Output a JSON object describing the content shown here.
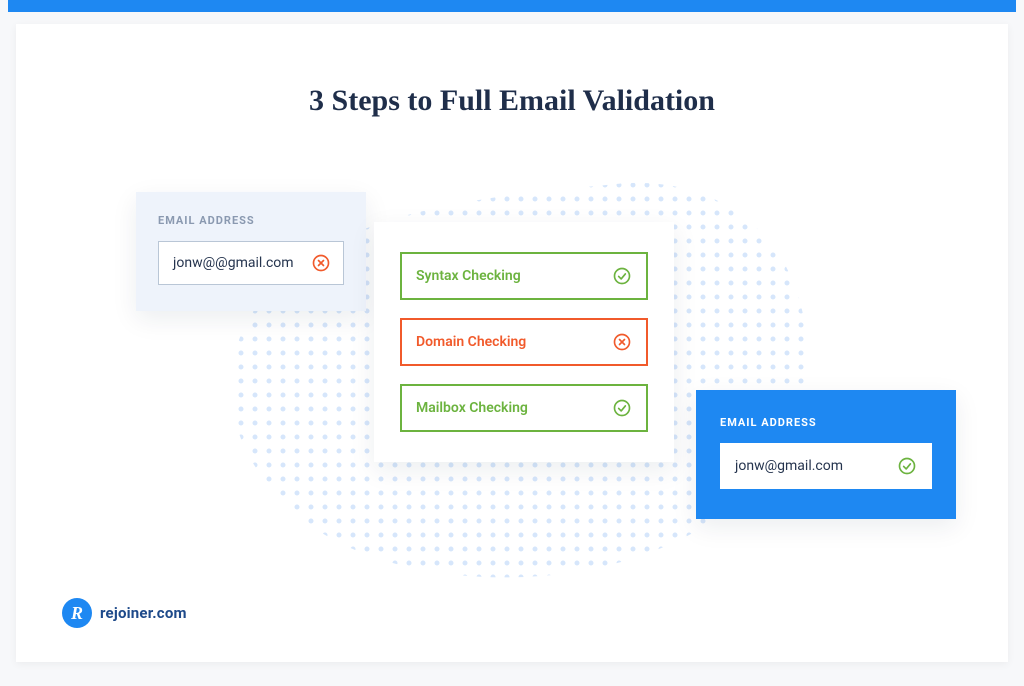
{
  "title": "3 Steps to Full Email Validation",
  "left_panel": {
    "label": "EMAIL ADDRESS",
    "value": "jonw@@gmail.com",
    "status": "error"
  },
  "steps": [
    {
      "label": "Syntax Checking",
      "status": "ok"
    },
    {
      "label": "Domain Checking",
      "status": "error"
    },
    {
      "label": "Mailbox Checking",
      "status": "ok"
    }
  ],
  "right_panel": {
    "label": "EMAIL ADDRESS",
    "value": "jonw@gmail.com",
    "status": "ok"
  },
  "footer": {
    "brand": "rejoiner.com",
    "badge_letter": "R"
  },
  "colors": {
    "accent": "#1e88f2",
    "success": "#6cb33f",
    "error": "#f15a2b",
    "text": "#1f2e4a"
  }
}
